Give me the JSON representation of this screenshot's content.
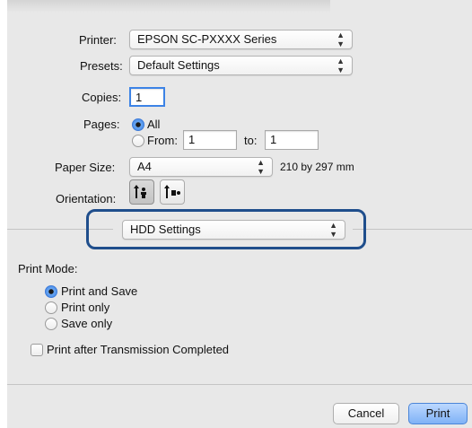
{
  "printer": {
    "label": "Printer:",
    "value": "EPSON SC-PXXXX Series"
  },
  "presets": {
    "label": "Presets:",
    "value": "Default Settings"
  },
  "copies": {
    "label": "Copies:",
    "value": "1"
  },
  "pages": {
    "label": "Pages:",
    "all_label": "All",
    "from_label": "From:",
    "from_value": "1",
    "to_label": "to:",
    "to_value": "1"
  },
  "paper_size": {
    "label": "Paper Size:",
    "value": "A4",
    "dimensions": "210 by 297 mm"
  },
  "orientation": {
    "label": "Orientation:",
    "options": [
      "portrait-icon",
      "landscape-icon"
    ]
  },
  "panel_popup": {
    "value": "HDD Settings",
    "highlight_color": "#1f4e8c"
  },
  "print_mode": {
    "label": "Print Mode:",
    "options": [
      "Print and Save",
      "Print only",
      "Save only"
    ],
    "selected": "Print and Save"
  },
  "transmission_checkbox": {
    "label": "Print after Transmission Completed",
    "checked": false
  },
  "buttons": {
    "cancel": "Cancel",
    "print": "Print"
  }
}
